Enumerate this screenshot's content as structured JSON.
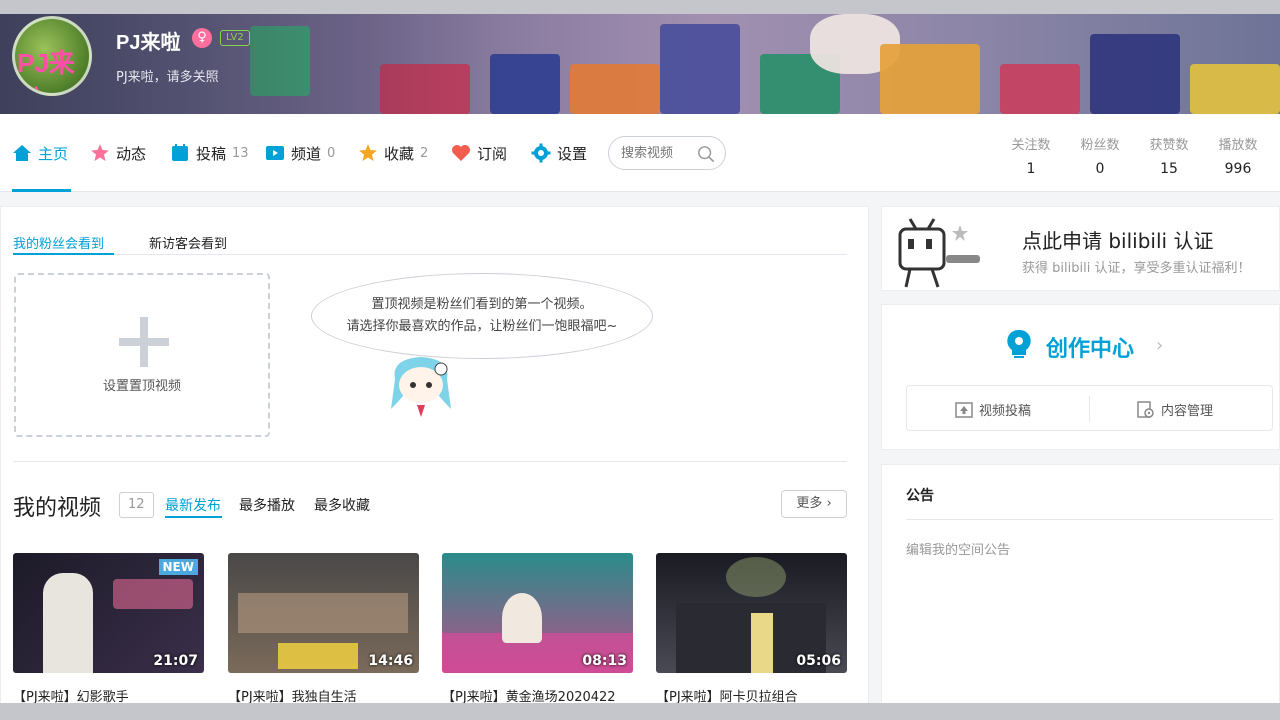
{
  "profile": {
    "username": "PJ来啦",
    "gender_icon": "♀",
    "level": "LV2",
    "signature": "PJ来啦，请多关照",
    "avatar_text": "PJ来啦"
  },
  "nav": {
    "items": [
      {
        "label": "主页",
        "count": "",
        "icon": "home-icon",
        "active": true
      },
      {
        "label": "动态",
        "count": "",
        "icon": "dynamic-icon"
      },
      {
        "label": "投稿",
        "count": "13",
        "icon": "upload-icon"
      },
      {
        "label": "频道",
        "count": "0",
        "icon": "channel-icon"
      },
      {
        "label": "收藏",
        "count": "2",
        "icon": "star-icon"
      },
      {
        "label": "订阅",
        "count": "",
        "icon": "heart-icon"
      },
      {
        "label": "设置",
        "count": "",
        "icon": "gear-icon"
      }
    ],
    "search_placeholder": "搜索视频",
    "stats": [
      {
        "label": "关注数",
        "value": "1"
      },
      {
        "label": "粉丝数",
        "value": "0"
      },
      {
        "label": "获赞数",
        "value": "15"
      },
      {
        "label": "播放数",
        "value": "996"
      }
    ]
  },
  "pinned": {
    "tabs": [
      "我的粉丝会看到",
      "新访客会看到"
    ],
    "set_label": "设置置顶视频",
    "bubble_line1": "置顶视频是粉丝们看到的第一个视频。",
    "bubble_line2": "请选择你最喜欢的作品，让粉丝们一饱眼福吧~"
  },
  "videos": {
    "title": "我的视频",
    "count": "12",
    "tabs": [
      "最新发布",
      "最多播放",
      "最多收藏"
    ],
    "more": "更多 ›",
    "list": [
      {
        "title": "【PJ来啦】幻影歌手",
        "duration": "21:07",
        "badge": "NEW",
        "colors": [
          "#1c1a28",
          "#3b2f4a"
        ]
      },
      {
        "title": "【PJ来啦】我独自生活",
        "duration": "14:46",
        "badge": "",
        "colors": [
          "#3d3a3a",
          "#7a6a5a"
        ]
      },
      {
        "title": "【PJ来啦】黄金渔场2020422",
        "duration": "08:13",
        "badge": "",
        "colors": [
          "#2a8c8a",
          "#b8508a"
        ]
      },
      {
        "title": "【PJ来啦】阿卡贝拉组合",
        "duration": "05:06",
        "badge": "",
        "colors": [
          "#1a1a22",
          "#4a4a55"
        ]
      }
    ]
  },
  "cert": {
    "title": "点此申请 bilibili 认证",
    "subtitle": "获得 bilibili 认证，享受多重认证福利！"
  },
  "creator": {
    "title": "创作中心",
    "arrow": "›",
    "upload_label": "视频投稿",
    "manage_label": "内容管理"
  },
  "notice": {
    "title": "公告",
    "placeholder": "编辑我的空间公告"
  },
  "colors": {
    "accent": "#00a1d6",
    "pink": "#fb7299"
  }
}
